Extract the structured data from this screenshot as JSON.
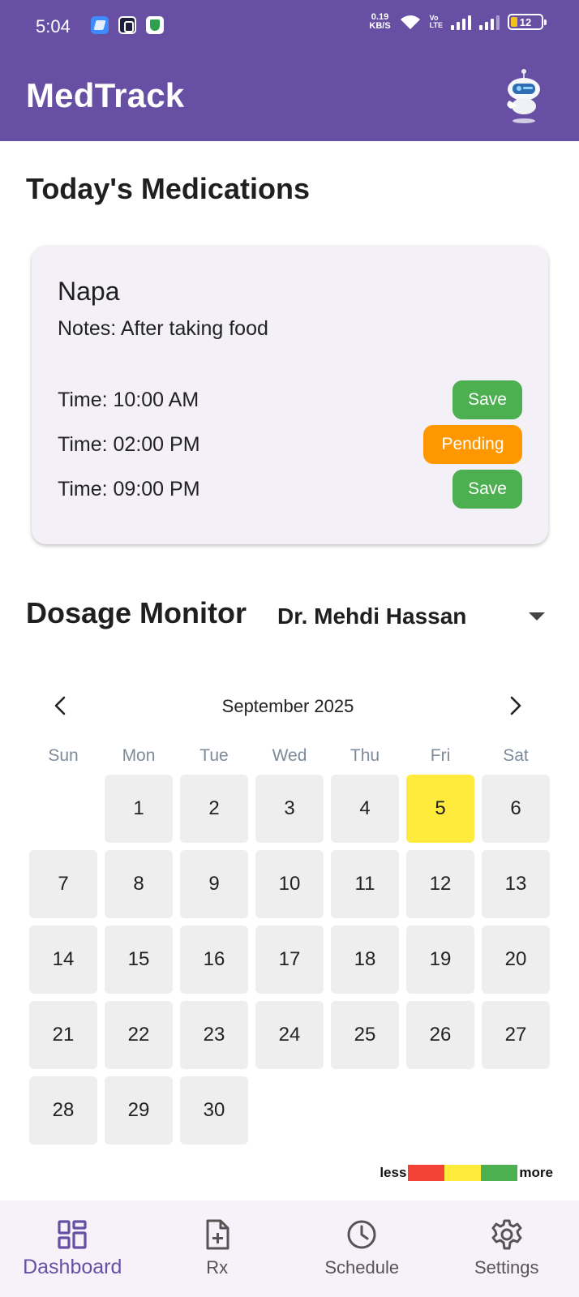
{
  "status_bar": {
    "time": "5:04",
    "net_speed_value": "0.19",
    "net_speed_unit": "KB/S",
    "volte_top": "Vo",
    "volte_bottom": "LTE",
    "battery": "12"
  },
  "app_bar": {
    "title": "MedTrack",
    "avatar_icon": "robot-avatar-icon"
  },
  "today": {
    "section_title": "Today's Medications",
    "card": {
      "name": "Napa",
      "notes": "Notes: After taking food",
      "doses": [
        {
          "time": "Time: 10:00 AM",
          "status": "Save",
          "color": "#4CAF50"
        },
        {
          "time": "Time: 02:00 PM",
          "status": "Pending",
          "color": "#FF9800"
        },
        {
          "time": "Time: 09:00 PM",
          "status": "Save",
          "color": "#4CAF50"
        }
      ]
    }
  },
  "dosage": {
    "section_title": "Dosage Monitor",
    "doctor": "Dr. Mehdi Hassan"
  },
  "calendar": {
    "month_label": "September 2025",
    "weekdays": [
      "Sun",
      "Mon",
      "Tue",
      "Wed",
      "Thu",
      "Fri",
      "Sat"
    ],
    "days": [
      "1",
      "2",
      "3",
      "4",
      "5",
      "6",
      "7",
      "8",
      "9",
      "10",
      "11",
      "12",
      "13",
      "14",
      "15",
      "16",
      "17",
      "18",
      "19",
      "20",
      "21",
      "22",
      "23",
      "24",
      "25",
      "26",
      "27",
      "28",
      "29",
      "30"
    ],
    "first_weekday_index": 1,
    "highlighted_day": "5",
    "highlight_color": "#FFEB3B",
    "cell_color": "#EEEEEE"
  },
  "legend": {
    "less": "less",
    "more": "more",
    "colors": [
      "#F44336",
      "#FFEB3B",
      "#4CAF50"
    ]
  },
  "bottom_nav": {
    "items": [
      {
        "label": "Dashboard",
        "icon": "dashboard-icon",
        "active": true
      },
      {
        "label": "Rx",
        "icon": "add-document-icon",
        "active": false
      },
      {
        "label": "Schedule",
        "icon": "clock-icon",
        "active": false
      },
      {
        "label": "Settings",
        "icon": "gear-icon",
        "active": false
      }
    ],
    "active_color": "#6750A4"
  },
  "theme": {
    "primary": "#6750A4",
    "card_bg": "#F4F0F8",
    "nav_bg": "#F7F1FA"
  }
}
